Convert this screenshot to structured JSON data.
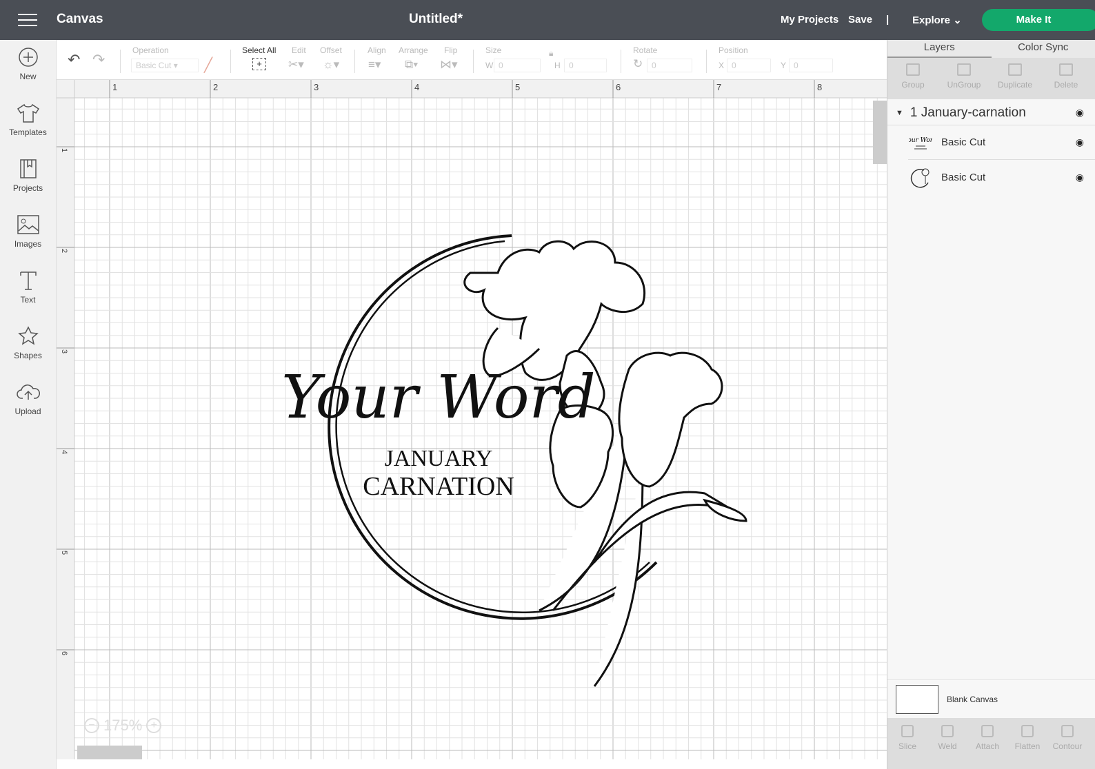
{
  "header": {
    "app": "Canvas",
    "title": "Untitled*",
    "my_projects": "My Projects",
    "save": "Save",
    "sep": "|",
    "explore": "Explore",
    "make_it": "Make It"
  },
  "sidebar": [
    {
      "label": "New",
      "icon": "plus-icon"
    },
    {
      "label": "Templates",
      "icon": "shirt-icon"
    },
    {
      "label": "Projects",
      "icon": "book-icon"
    },
    {
      "label": "Images",
      "icon": "image-icon"
    },
    {
      "label": "Text",
      "icon": "text-icon"
    },
    {
      "label": "Shapes",
      "icon": "shapes-icon"
    },
    {
      "label": "Upload",
      "icon": "upload-icon"
    }
  ],
  "toolbar": {
    "operation": "Operation",
    "operation_value": "Basic Cut",
    "select_all": "Select All",
    "edit": "Edit",
    "offset": "Offset",
    "align": "Align",
    "arrange": "Arrange",
    "flip": "Flip",
    "size": "Size",
    "w": "W",
    "h": "H",
    "w_val": "0",
    "h_val": "0",
    "rotate": "Rotate",
    "rotate_val": "0",
    "position": "Position",
    "x": "X",
    "y": "Y",
    "x_val": "0",
    "y_val": "0"
  },
  "ruler": {
    "h": [
      "1",
      "2",
      "3",
      "4",
      "5",
      "6",
      "7",
      "8"
    ],
    "v": [
      "1",
      "2",
      "3",
      "4",
      "5",
      "6"
    ]
  },
  "artwork": {
    "script": "Your Word",
    "line1": "JANUARY",
    "line2": "CARNATION"
  },
  "zoom": {
    "value": "175%",
    "minus": "−",
    "plus": "+"
  },
  "panel": {
    "tabs": [
      "Layers",
      "Color Sync"
    ],
    "tools": [
      "Group",
      "UnGroup",
      "Duplicate",
      "Delete"
    ],
    "group": "1 January-carnation",
    "layers": [
      "Basic Cut",
      "Basic Cut"
    ],
    "blank": "Blank Canvas",
    "bottom": [
      "Slice",
      "Weld",
      "Attach",
      "Flatten",
      "Contour"
    ]
  }
}
